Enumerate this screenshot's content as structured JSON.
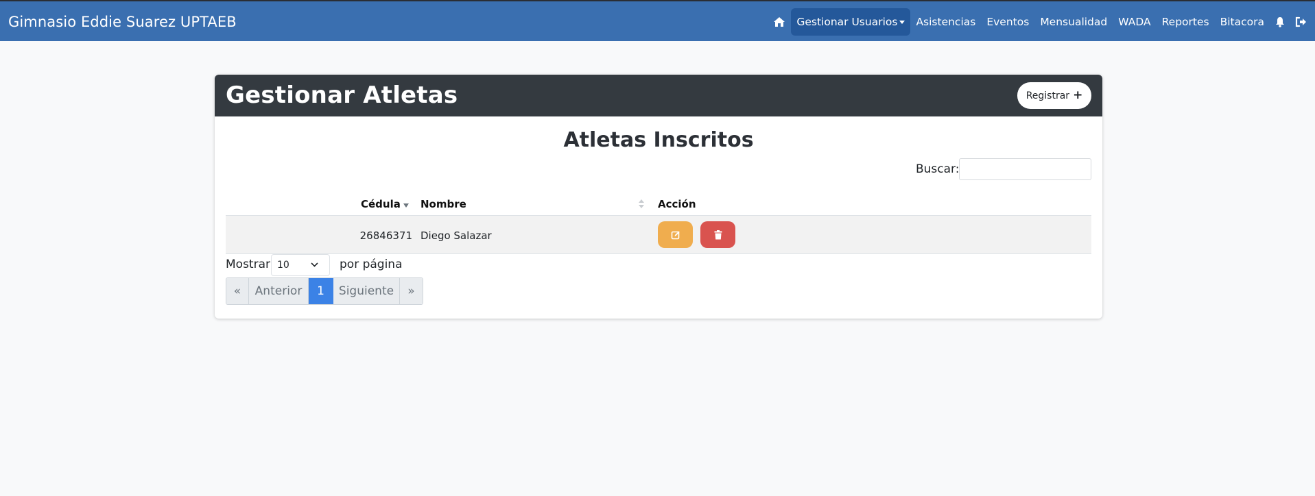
{
  "navbar": {
    "brand": "Gimnasio Eddie Suarez UPTAEB",
    "items": [
      {
        "label": "Gestionar Usuarios",
        "active": true,
        "dropdown": true
      },
      {
        "label": "Asistencias"
      },
      {
        "label": "Eventos"
      },
      {
        "label": "Mensualidad"
      },
      {
        "label": "WADA"
      },
      {
        "label": "Reportes"
      },
      {
        "label": "Bitacora"
      }
    ],
    "icons": [
      "home-icon",
      "bell-icon",
      "logout-icon"
    ]
  },
  "card": {
    "title": "Gestionar Atletas",
    "register_label": "Registrar",
    "subtitle": "Atletas Inscritos",
    "search_label": "Buscar:",
    "search_value": ""
  },
  "table": {
    "columns": [
      "Cédula",
      "Nombre",
      "Acción"
    ],
    "rows": [
      {
        "cedula": "26846371",
        "nombre": "Diego Salazar"
      }
    ],
    "row_actions": [
      "edit-icon",
      "trash-icon"
    ]
  },
  "length": {
    "prefix": "Mostrar",
    "value": "10",
    "suffix": "por página"
  },
  "pagination": {
    "first": "«",
    "prev": "Anterior",
    "current": "1",
    "next": "Siguiente",
    "last": "»"
  },
  "colors": {
    "navbar": "#3a6fb0",
    "card_header": "#343a40",
    "edit": "#f0ad4e",
    "delete": "#d9534f",
    "page_active": "#3b82e6"
  }
}
